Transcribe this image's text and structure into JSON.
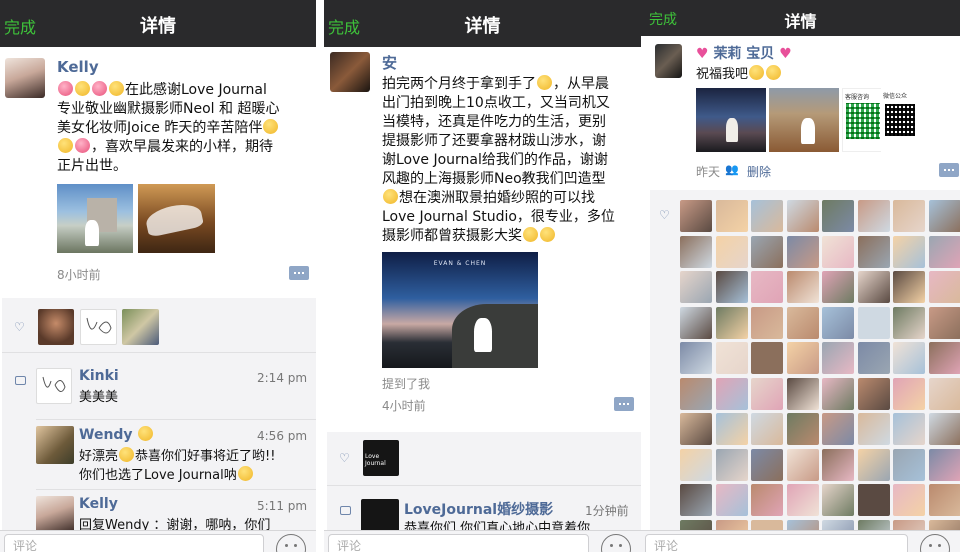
{
  "panels": [
    {
      "nav": {
        "done": "完成",
        "title": "详情"
      },
      "post": {
        "author": "Kelly",
        "text_line1_suffix": "在此感谢Love Journal",
        "text_line2": "专业敬业幽默摄影师Neol 和 超暖心",
        "text_line3": "美女化妆师Joice 昨天的辛苦陪伴",
        "text_line4": "，喜欢早晨发来的小样，期待",
        "text_line5": "正片出世。",
        "time": "8小时前"
      },
      "comments": [
        {
          "name": "Kinki",
          "time": "2:14 pm",
          "text": "美美美"
        },
        {
          "name": "Wendy",
          "time": "4:56 pm",
          "text_a": "好漂亮",
          "text_b": "恭喜你们好事将近了哟!!",
          "text_c": "你们也选了Love Journal呐"
        },
        {
          "name": "Kelly",
          "time": "5:11 pm",
          "text": "回复Wendy ：谢谢，哪呐，你们"
        }
      ],
      "input_placeholder": "评论"
    },
    {
      "nav": {
        "done": "完成",
        "title": "详情"
      },
      "post": {
        "author": "安",
        "lines": [
          "拍完两个月终于拿到手了",
          "出门拍到晚上10点收工，又当司机又",
          "当模特，还真是件吃力的生活，更别",
          "提摄影师了还要拿器材跋山涉水，谢",
          "谢Love Journal给我们的作品，谢谢",
          "风趣的上海摄影师Neo教我们凹造型",
          "想在澳洲取景拍婚纱照的可以找",
          "Love Journal Studio，很专业，多位",
          "摄影师都曾获摄影大奖"
        ],
        "line1_suffix": "，从早晨",
        "mention": "提到了我",
        "time": "4小时前",
        "photo_caption": "EVAN & CHEN"
      },
      "comment": {
        "name": "LoveJournal婚纱摄影",
        "time": "1分钟前",
        "text": "恭喜你们 你们真心地心中意着你"
      },
      "like_avatar_text": "Love Journal",
      "input_placeholder": "评论"
    },
    {
      "nav": {
        "done": "完成",
        "title": "详情"
      },
      "post": {
        "author": "茉莉 宝贝",
        "text": "祝福我吧",
        "time": "昨天",
        "delete": "删除",
        "qr_label1": "客服咨询",
        "qr_label2": "微信公众"
      },
      "input_placeholder": "评论"
    }
  ],
  "colors": {
    "accent": "#3ec23a",
    "link": "#4e6a97",
    "nav_bg": "#2a2a2c"
  }
}
